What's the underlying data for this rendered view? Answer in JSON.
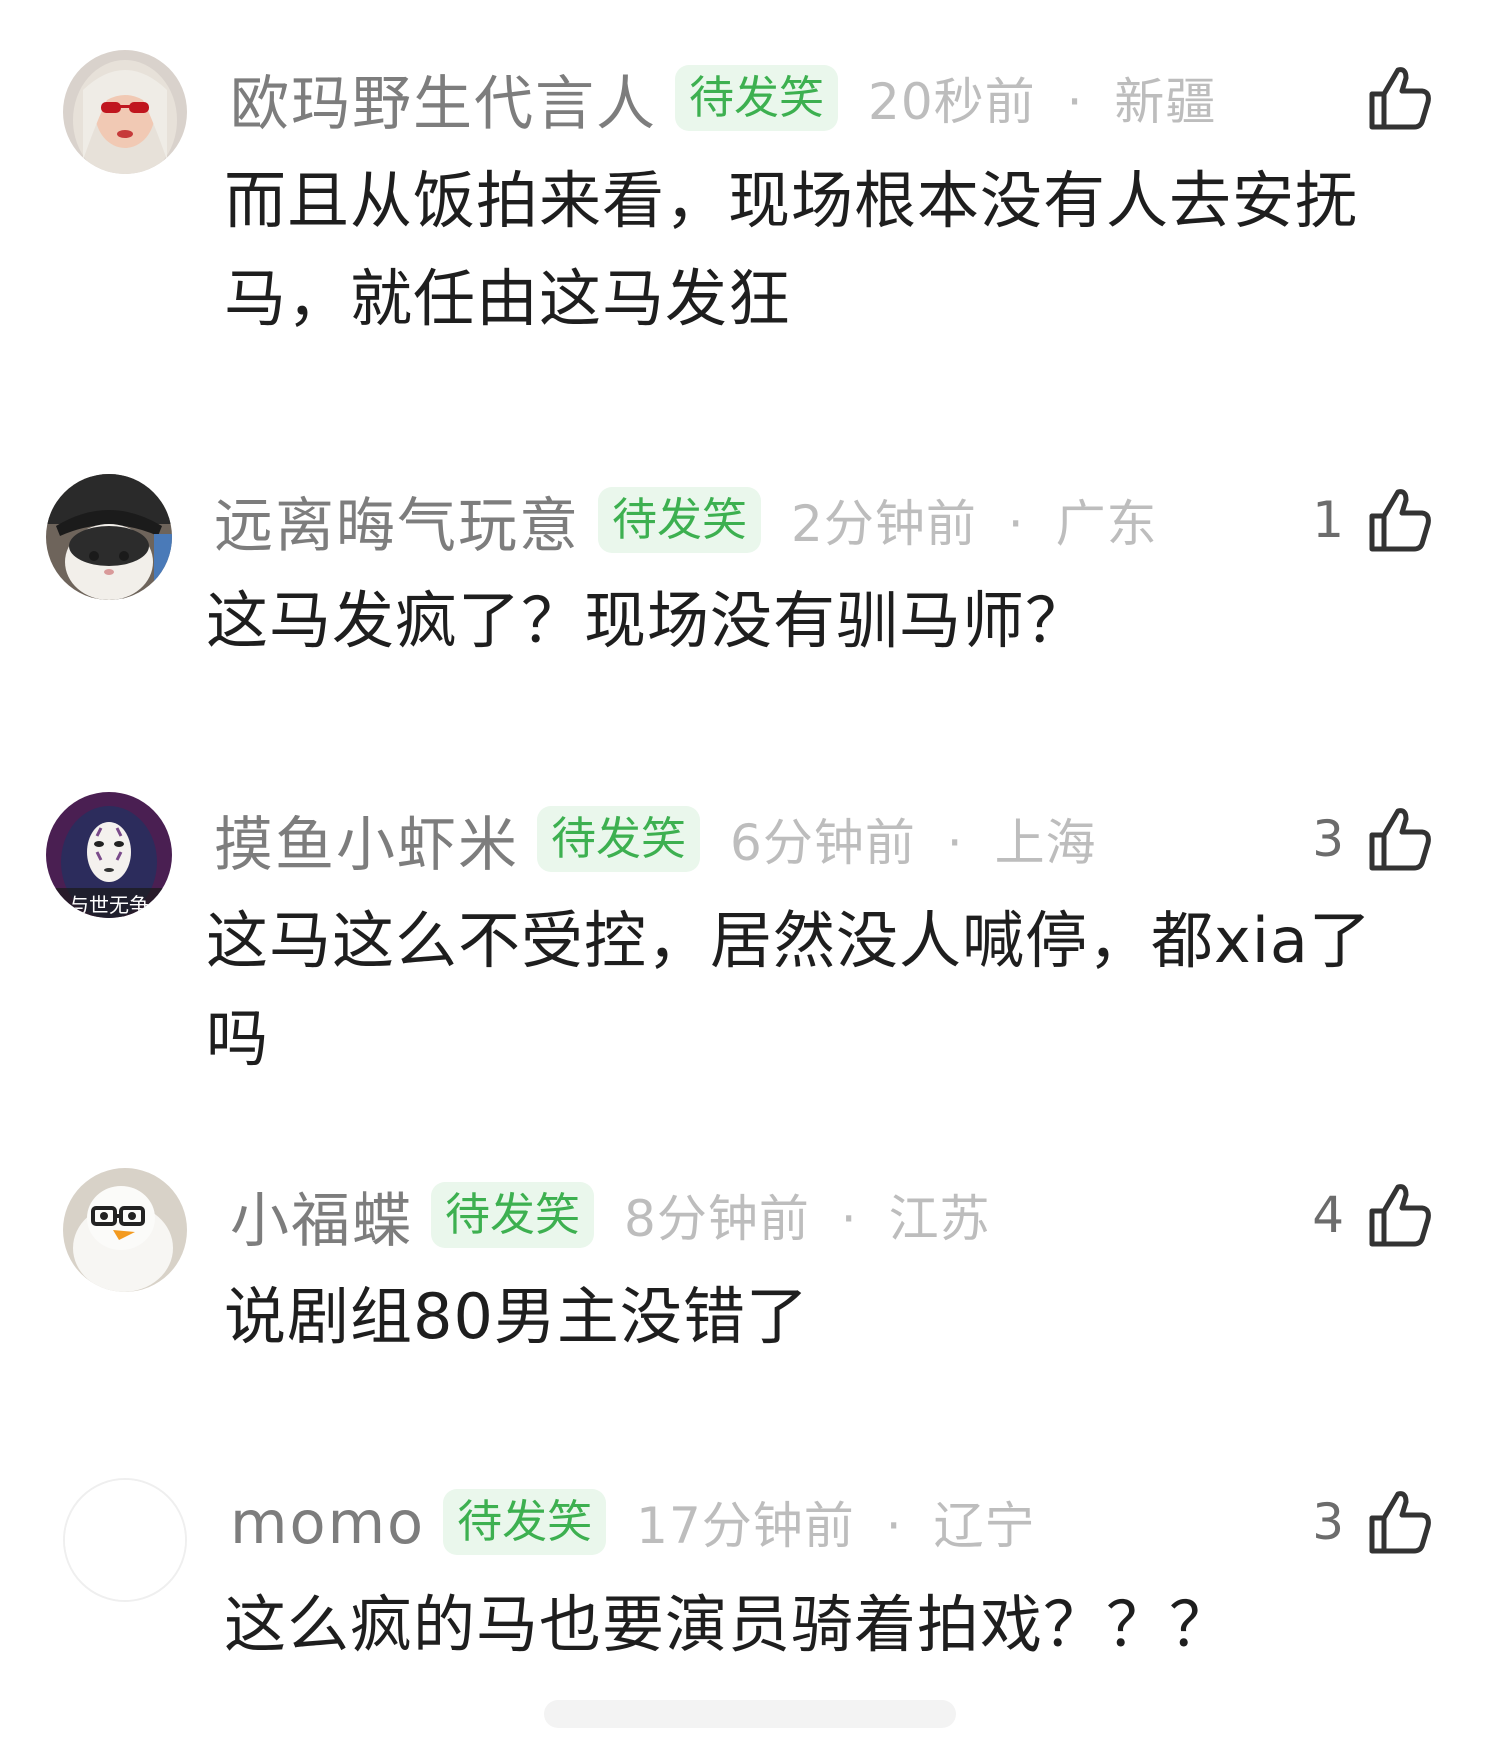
{
  "badge_label": "待发笑",
  "meta_separator": "·",
  "comments": [
    {
      "username": "欧玛野生代言人",
      "time": "20秒前",
      "location": "新疆",
      "likes": "",
      "text": "而且从饭拍来看，现场根本没有人去安抚马，就任由这马发狂",
      "avatar": "woman-blonde-sunglasses"
    },
    {
      "username": "远离晦气玩意",
      "time": "2分钟前",
      "location": "广东",
      "likes": "1",
      "text": "这马发疯了？现场没有驯马师？",
      "avatar": "cat-with-cap"
    },
    {
      "username": "摸鱼小虾米",
      "time": "6分钟前",
      "location": "上海",
      "likes": "3",
      "text": "这马这么不受控，居然没人喊停，都xia了吗",
      "avatar": "no-face-mask"
    },
    {
      "username": "小福蝶",
      "time": "8分钟前",
      "location": "江苏",
      "likes": "4",
      "text": "说剧组80男主没错了",
      "avatar": "white-duck-glasses"
    },
    {
      "username": "momo",
      "time": "17分钟前",
      "location": "辽宁",
      "likes": "3",
      "text": "这么疯的马也要演员骑着拍戏？？？",
      "avatar": "blank"
    }
  ],
  "colors": {
    "badge_bg": "#eaf7ec",
    "badge_text": "#3db050",
    "username": "#7d7d7d",
    "meta": "#bdbdbd",
    "content": "#1e1e1e"
  }
}
